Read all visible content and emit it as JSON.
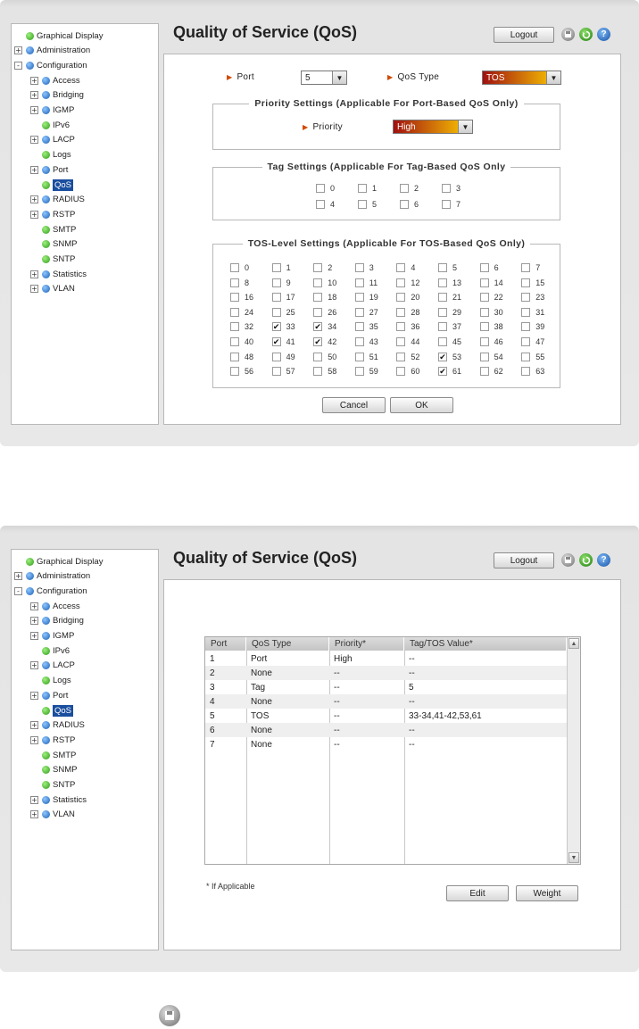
{
  "screen1": {
    "title": "Quality of Service (QoS)",
    "logout": "Logout",
    "port_label": "Port",
    "port_value": "5",
    "qos_type_label": "QoS Type",
    "qos_type_value": "TOS",
    "priority_legend": "Priority Settings (Applicable For Port-Based QoS Only)",
    "priority_label": "Priority",
    "priority_value": "High",
    "tag_legend": "Tag Settings (Applicable For Tag-Based QoS Only",
    "tos_legend": "TOS-Level Settings (Applicable For TOS-Based QoS Only)",
    "tag_checked": [],
    "tos_checked": [
      33,
      34,
      41,
      42,
      53,
      61
    ],
    "cancel": "Cancel",
    "ok": "OK"
  },
  "screen2": {
    "title": "Quality of Service (QoS)",
    "logout": "Logout",
    "columns": [
      "Port",
      "QoS Type",
      "Priority*",
      "Tag/TOS Value*"
    ],
    "rows": [
      [
        "1",
        "Port",
        "High",
        "--"
      ],
      [
        "2",
        "None",
        "--",
        "--"
      ],
      [
        "3",
        "Tag",
        "--",
        "5"
      ],
      [
        "4",
        "None",
        "--",
        "--"
      ],
      [
        "5",
        "TOS",
        "--",
        "33-34,41-42,53,61"
      ],
      [
        "6",
        "None",
        "--",
        "--"
      ],
      [
        "7",
        "None",
        "--",
        "--"
      ]
    ],
    "note": "* If Applicable",
    "edit": "Edit",
    "weight": "Weight"
  },
  "tree": [
    {
      "label": "Graphical Display",
      "level": 0,
      "expander": "",
      "bullet": "green"
    },
    {
      "label": "Administration",
      "level": 0,
      "expander": "+",
      "bullet": "blue"
    },
    {
      "label": "Configuration",
      "level": 0,
      "expander": "-",
      "bullet": "blue"
    },
    {
      "label": "Access",
      "level": 1,
      "expander": "+",
      "bullet": "blue"
    },
    {
      "label": "Bridging",
      "level": 1,
      "expander": "+",
      "bullet": "blue"
    },
    {
      "label": "IGMP",
      "level": 1,
      "expander": "+",
      "bullet": "blue"
    },
    {
      "label": "IPv6",
      "level": 1,
      "expander": "",
      "bullet": "green"
    },
    {
      "label": "LACP",
      "level": 1,
      "expander": "+",
      "bullet": "blue"
    },
    {
      "label": "Logs",
      "level": 1,
      "expander": "",
      "bullet": "green"
    },
    {
      "label": "Port",
      "level": 1,
      "expander": "+",
      "bullet": "blue"
    },
    {
      "label": "QoS",
      "level": 1,
      "expander": "",
      "bullet": "green",
      "selected": true
    },
    {
      "label": "RADIUS",
      "level": 1,
      "expander": "+",
      "bullet": "blue"
    },
    {
      "label": "RSTP",
      "level": 1,
      "expander": "+",
      "bullet": "blue"
    },
    {
      "label": "SMTP",
      "level": 1,
      "expander": "",
      "bullet": "green"
    },
    {
      "label": "SNMP",
      "level": 1,
      "expander": "",
      "bullet": "green"
    },
    {
      "label": "SNTP",
      "level": 1,
      "expander": "",
      "bullet": "green"
    },
    {
      "label": "Statistics",
      "level": 1,
      "expander": "+",
      "bullet": "blue"
    },
    {
      "label": "VLAN",
      "level": 1,
      "expander": "+",
      "bullet": "blue"
    }
  ],
  "icons": {
    "save": "save-icon",
    "refresh": "refresh-icon",
    "help": "help-icon"
  }
}
